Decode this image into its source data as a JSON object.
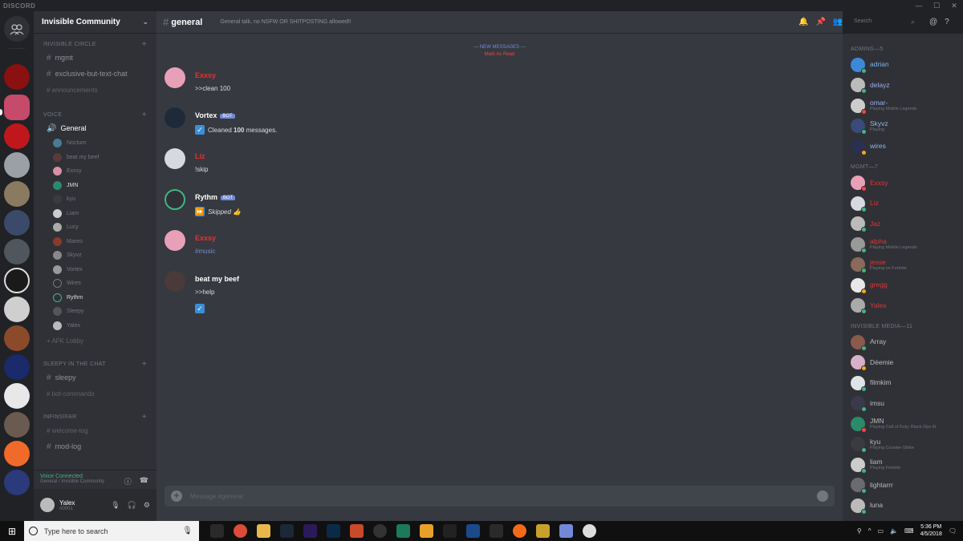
{
  "titlebar": {
    "brand": "DISCORD",
    "min": "—",
    "max": "☐",
    "close": "✕"
  },
  "server": {
    "name": "Invisible Community",
    "chevron": "⌄"
  },
  "sidebar": {
    "categories": [
      {
        "label": "INVISIBLE CIRCLE"
      },
      {
        "label": "VOICE"
      },
      {
        "label": "SLEEPY IN THE CHAT"
      },
      {
        "label": "INFINSIFAR"
      }
    ],
    "channels": {
      "mgmt": "mgmt",
      "exclusive": "exclusive-but-text-chat",
      "faded1": "# announcements",
      "general": "General",
      "afk": "+ AFK Lobby",
      "sleepy": "sleepy",
      "faded2": "# bot-commands",
      "faded3": "# welcome-log",
      "modlog": "mod-log"
    },
    "voice_users": [
      {
        "name": "Nocturn"
      },
      {
        "name": "beat my beef"
      },
      {
        "name": "Exxsy"
      },
      {
        "name": "JMN"
      },
      {
        "name": "kyu"
      },
      {
        "name": "Liam"
      },
      {
        "name": "Lucy"
      },
      {
        "name": "Mareo"
      },
      {
        "name": "Skyvz"
      },
      {
        "name": "Vortex"
      },
      {
        "name": "Wires"
      },
      {
        "name": "Rythm"
      },
      {
        "name": "Sleepy"
      },
      {
        "name": "Yalex"
      }
    ]
  },
  "voicebar": {
    "status": "Voice Connected",
    "sub": "General / Invisible Community"
  },
  "userbar": {
    "name": "Yalex",
    "tag": "#0001"
  },
  "chat": {
    "channel": "general",
    "topic": "General talk, no NSFW OR SHITPOSTING allowed!!",
    "new_messages": "— NEW MESSAGES —",
    "jump": "Mark As Read",
    "composer_placeholder": "Message #general",
    "messages": [
      {
        "author": "Exxsy",
        "bot": "",
        "text": ">>clean 100"
      },
      {
        "author": "Vortex",
        "bot": "BOT",
        "text_pre": "Cleaned ",
        "text_bold": "100",
        "text_post": " messages."
      },
      {
        "author": "Liz",
        "bot": "",
        "text": "!skip"
      },
      {
        "author": "Rythm",
        "bot": "BOT",
        "text": "Skipped 👍"
      },
      {
        "author": "Exxsy",
        "bot": "",
        "text": "#music"
      },
      {
        "author": "beat my beef",
        "bot": "",
        "text": ">>help"
      }
    ]
  },
  "search": {
    "placeholder": "Search"
  },
  "members": {
    "categories": {
      "c1": "ADMINS—5",
      "c2": "MGMT—7",
      "c3": "INVISIBLE MEDIA—11"
    },
    "admins": [
      {
        "name": "adrian",
        "sub": ""
      },
      {
        "name": "delayz",
        "sub": ""
      },
      {
        "name": "omar-",
        "sub": "Playing Mobile Legends"
      },
      {
        "name": "Skyvz",
        "sub": "Playing"
      },
      {
        "name": "wires",
        "sub": ""
      }
    ],
    "mgmt": [
      {
        "name": "Exxsy",
        "sub": ""
      },
      {
        "name": "Liz",
        "sub": ""
      },
      {
        "name": "Jaz",
        "sub": ""
      },
      {
        "name": "alpha",
        "sub": "Playing Mobile Legends"
      },
      {
        "name": "jesse",
        "sub": "Playing on Fortnite"
      },
      {
        "name": "gregg",
        "sub": ""
      },
      {
        "name": "Yalex",
        "sub": ""
      }
    ],
    "media": [
      {
        "name": "Array",
        "sub": ""
      },
      {
        "name": "Déemie",
        "sub": ""
      },
      {
        "name": "filmkim",
        "sub": ""
      },
      {
        "name": "imsu",
        "sub": ""
      },
      {
        "name": "JMN",
        "sub": "Playing Call of Duty: Black Ops III"
      },
      {
        "name": "kyu",
        "sub": "Playing Counter-Strike"
      },
      {
        "name": "liam",
        "sub": "Playing Fortnite"
      },
      {
        "name": "lightarrr",
        "sub": ""
      },
      {
        "name": "luna",
        "sub": ""
      }
    ]
  },
  "taskbar": {
    "search_placeholder": "Type here to search",
    "time": "5:36 PM",
    "date": "4/5/2018"
  },
  "colors": {
    "blurple": "#7289da",
    "online": "#43b581",
    "idle": "#faa61a",
    "dnd": "#f04747",
    "admin_red": "#e03434"
  }
}
